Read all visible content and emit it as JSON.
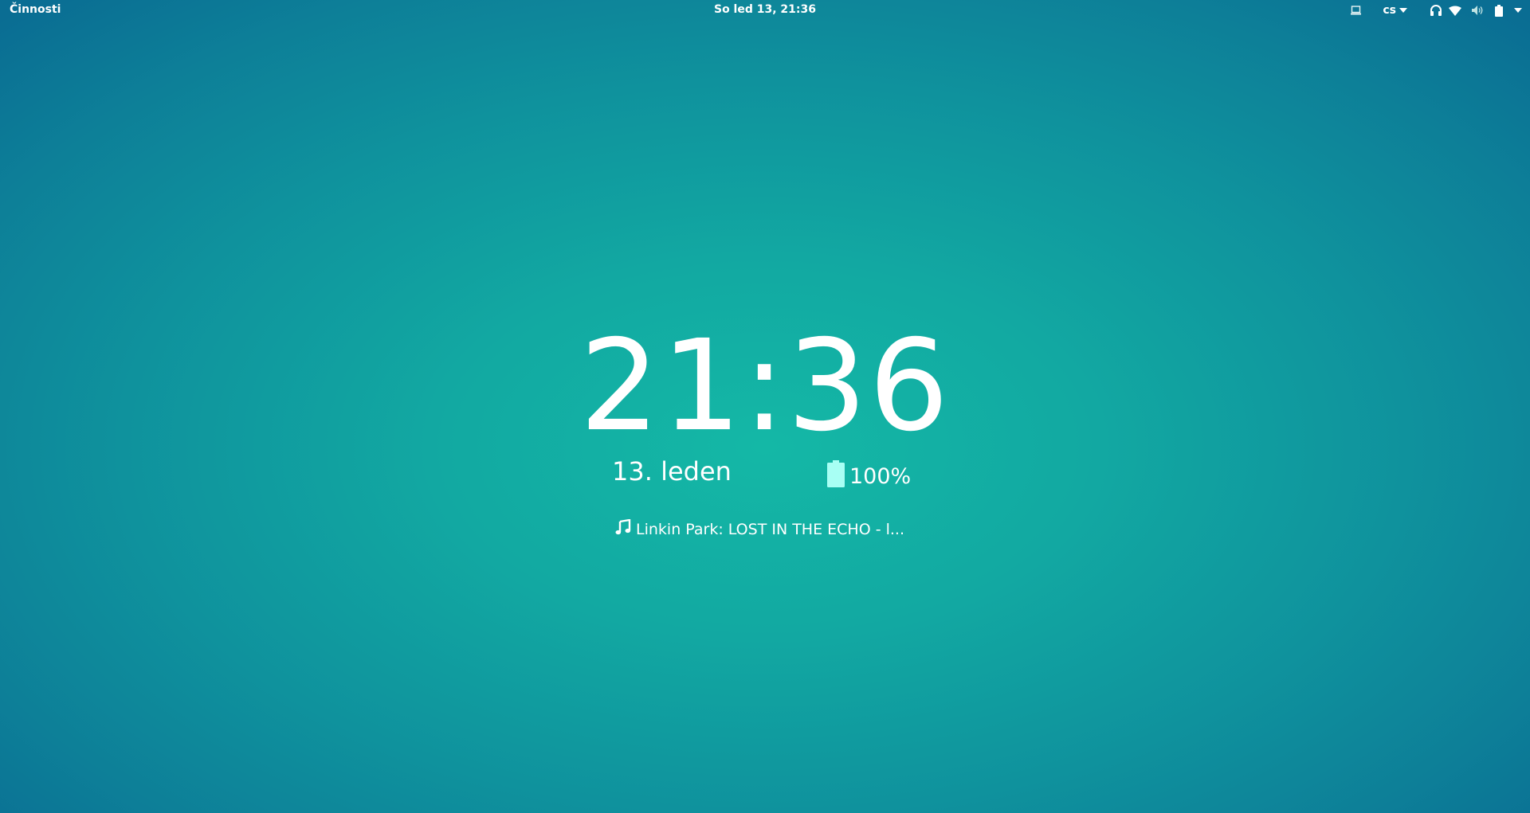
{
  "topbar": {
    "activities": "Činnosti",
    "datetime": "So led 13, 21:36",
    "language": "cs",
    "icons": [
      "screen-icon",
      "headphones-icon",
      "wifi-icon",
      "volume-icon",
      "battery-icon"
    ]
  },
  "lockscreen": {
    "time": "21:36",
    "date": "13. leden",
    "battery_percent": "100%",
    "battery_level": 1.0,
    "now_playing": "Linkin Park: LOST IN THE ECHO - l..."
  },
  "colors": {
    "background_center": "#14b8a6",
    "background_edge": "#0a6d93",
    "battery_fill": "#a8fff4",
    "text": "#ffffff"
  }
}
